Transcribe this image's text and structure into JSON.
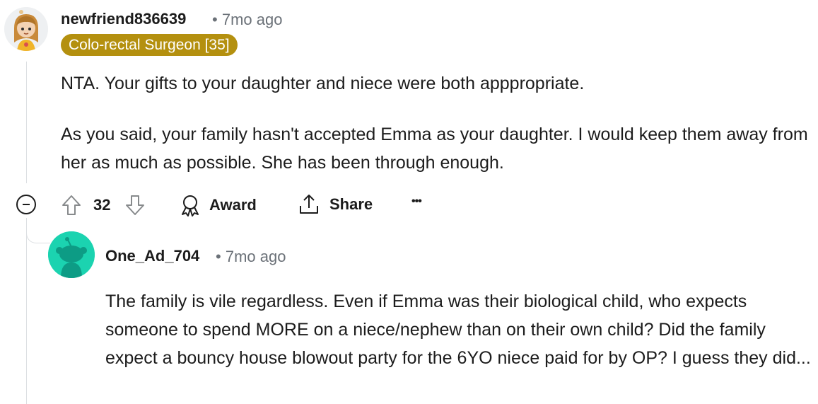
{
  "comments": [
    {
      "username": "newfriend836639",
      "time": "7mo ago",
      "flair": "Colo-rectal Surgeon [35]",
      "paragraphs": [
        "NTA. Your gifts to your daughter and niece were both apppropriate.",
        "As you said, your family hasn't accepted Emma as your daughter. I would keep them away from her as much as possible. She has been through enough."
      ],
      "votes": "32",
      "actions": {
        "award": "Award",
        "share": "Share",
        "more": "•••"
      }
    },
    {
      "username": "One_Ad_704",
      "time": "7mo ago",
      "paragraphs": [
        "The family is vile regardless. Even if Emma was their biological child, who expects someone to spend MORE on a niece/nephew than on their own child? Did the family expect a bouncy house blowout party for the 6YO niece paid for by OP? I guess they did..."
      ]
    }
  ],
  "meta_separator": "•",
  "icons": {
    "collapse": "collapse-minus-icon",
    "upvote": "upvote-arrow-icon",
    "downvote": "downvote-arrow-icon",
    "award": "award-ribbon-icon",
    "share": "share-upload-icon",
    "more": "more-dots-icon"
  },
  "colors": {
    "flair_bg": "#b4900f",
    "avatar2_bg": "#1bd3b0",
    "meta_text": "#6b7178",
    "thread_line": "#dcdfe2"
  }
}
